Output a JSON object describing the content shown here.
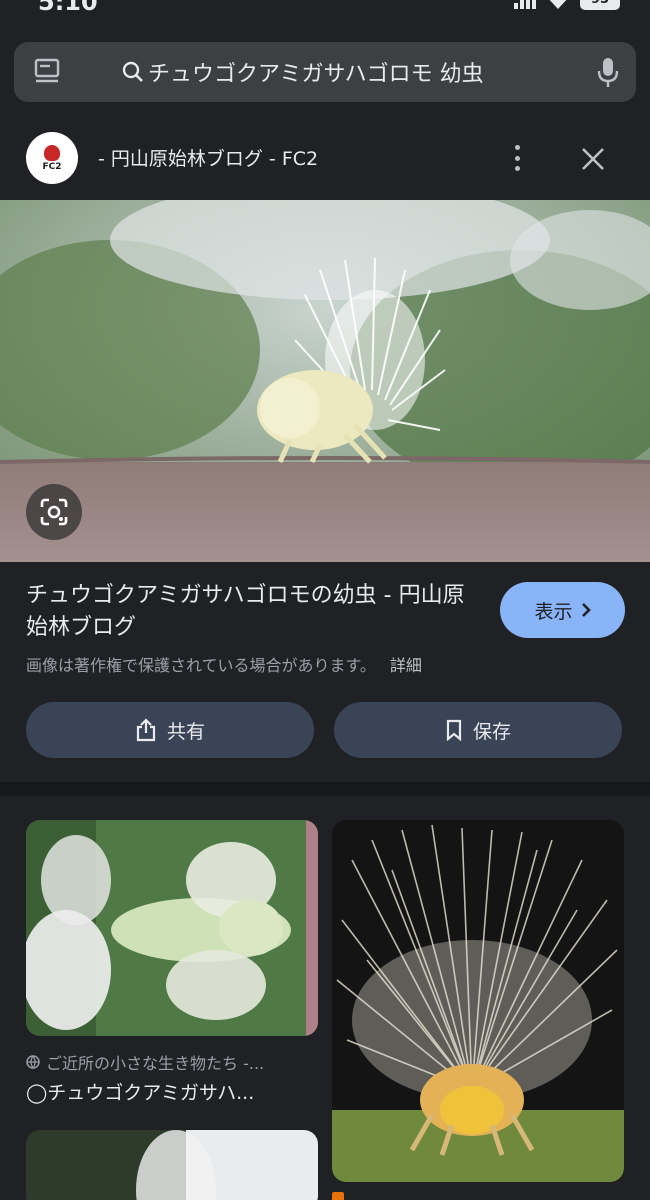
{
  "status": {
    "time": "5:10",
    "battery": "95"
  },
  "search": {
    "query": "チュウゴクアミガサハゴロモ 幼虫"
  },
  "source": {
    "logo_text": "FC2",
    "title": "- 円山原始林ブログ - FC2"
  },
  "result": {
    "title": "チュウゴクアミガサハゴロモの幼虫 - 円山原始林ブログ",
    "view_label": "表示",
    "copyright": "画像は著作権で保護されている場合があります。",
    "details_label": "詳細",
    "share_label": "共有",
    "save_label": "保存"
  },
  "related": {
    "items": [
      {
        "source": "ご近所の小さな生き物たち -...",
        "caption": "◯チュウゴクアミガサハ..."
      }
    ]
  },
  "colors": {
    "background": "#202124",
    "accent": "#8ab4f8",
    "button": "#394457"
  }
}
